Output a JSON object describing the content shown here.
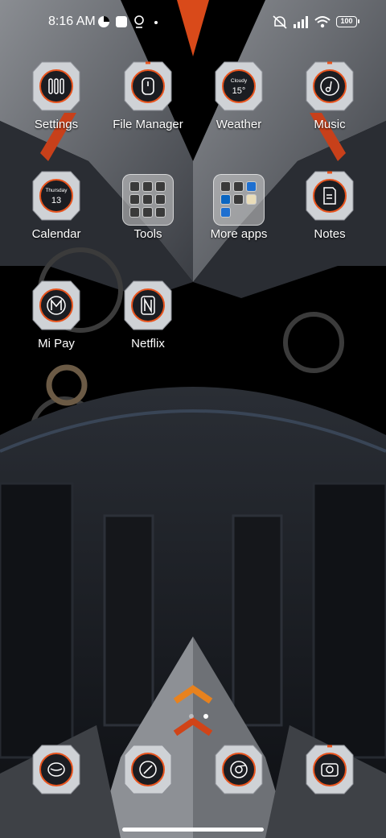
{
  "status_bar": {
    "time": "8:16 AM",
    "battery": "100",
    "icons": [
      "app-notification-icon",
      "square-notification-icon",
      "location-icon",
      "dot-icon",
      "mute-icon",
      "signal-icon",
      "wifi-icon",
      "battery-icon"
    ]
  },
  "home": {
    "apps": [
      {
        "label": "Settings",
        "icon": "settings-icon"
      },
      {
        "label": "File Manager",
        "icon": "file-manager-icon"
      },
      {
        "label": "Weather",
        "icon": "weather-icon",
        "widget_top": "Cloudy",
        "widget_value": "15°"
      },
      {
        "label": "Music",
        "icon": "music-icon"
      },
      {
        "label": "Calendar",
        "icon": "calendar-icon",
        "widget_top": "Thursday",
        "widget_value": "13"
      },
      {
        "label": "Tools",
        "icon": "tools-folder-icon"
      },
      {
        "label": "More apps",
        "icon": "more-apps-folder-icon"
      },
      {
        "label": "Notes",
        "icon": "notes-icon"
      },
      {
        "label": "Mi Pay",
        "icon": "mi-pay-icon"
      },
      {
        "label": "Netflix",
        "icon": "netflix-icon"
      }
    ]
  },
  "dock": [
    {
      "icon": "messaging-icon"
    },
    {
      "icon": "compass-icon"
    },
    {
      "icon": "chrome-icon"
    },
    {
      "icon": "camera-icon"
    }
  ],
  "page_indicator": {
    "current": 2,
    "total": 2
  },
  "colors": {
    "accent": "#e8541e",
    "frame": "#cfd2d6",
    "dark": "#1b1d22"
  }
}
